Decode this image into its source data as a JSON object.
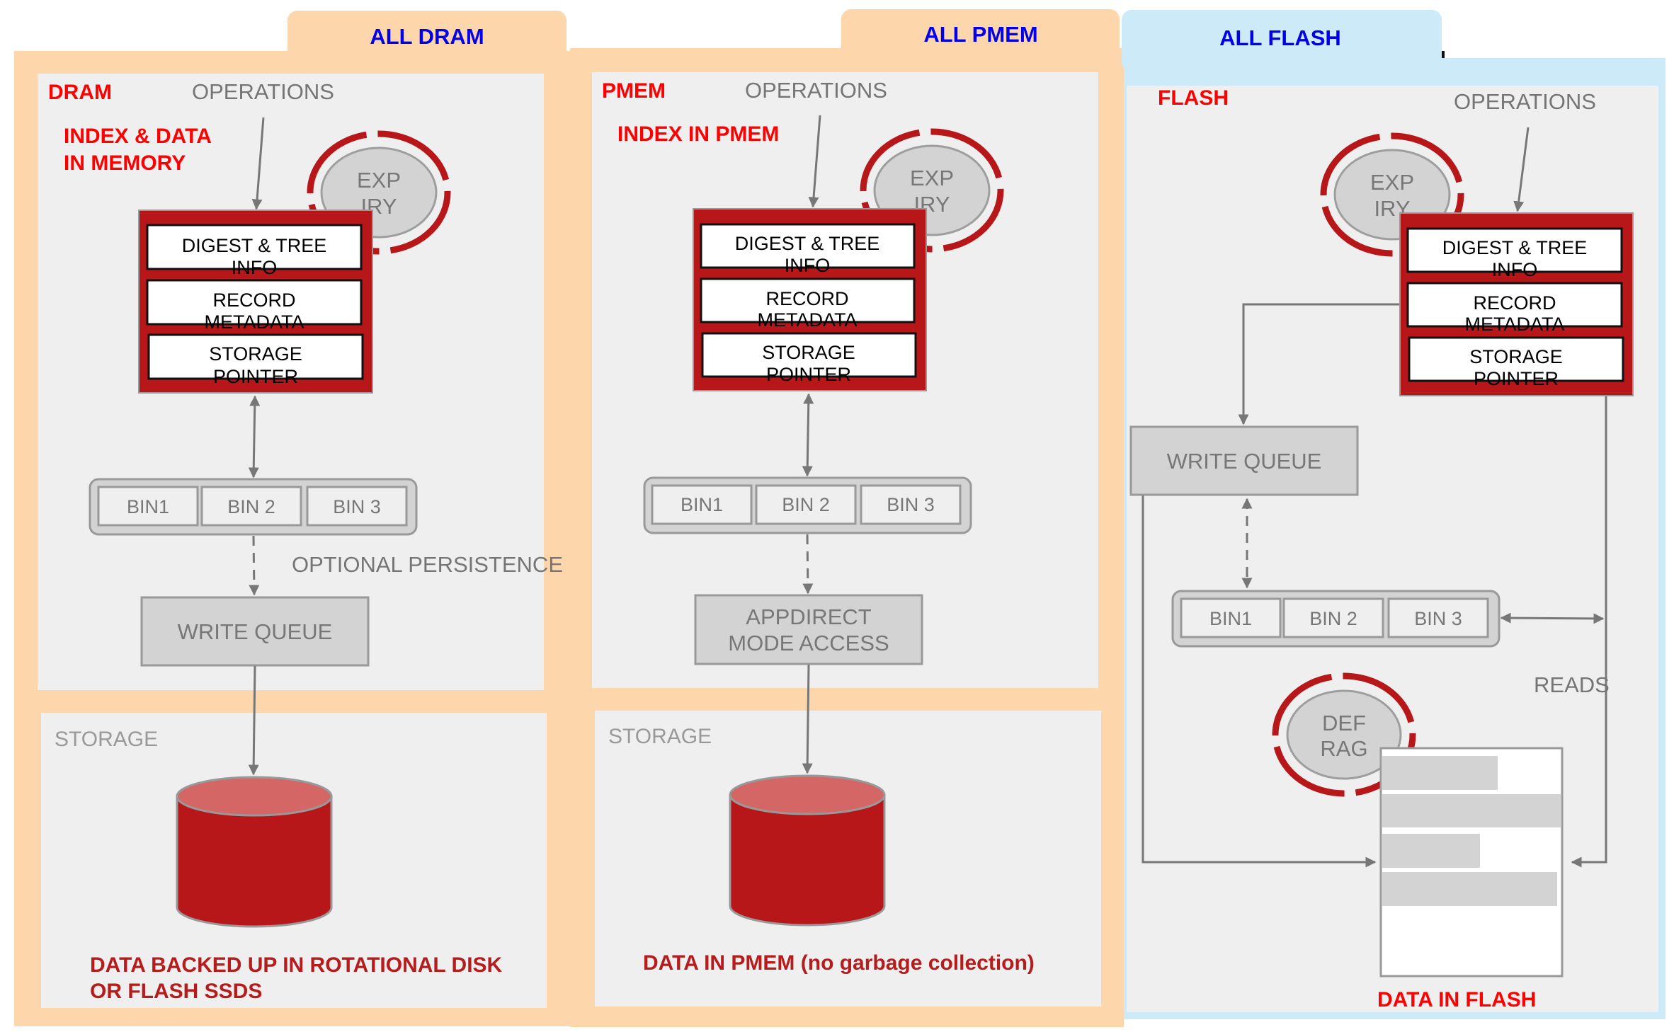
{
  "tabs": {
    "dram": "ALL DRAM",
    "pmem": "ALL PMEM",
    "flash": "ALL FLASH"
  },
  "colors": {
    "tab_title": "#0000ee",
    "zone_title": "#ff0000",
    "accent_red": "#b71719",
    "orange_frame": "#fed6ab",
    "blue_frame": "#cceaf7",
    "panel_gray": "#efefef"
  },
  "dram": {
    "zone_title": "DRAM",
    "operations": "OPERATIONS",
    "subtitle_line1": "INDEX & DATA",
    "subtitle_line2": "IN MEMORY",
    "expiry_line1": "EXP",
    "expiry_line2": "IRY",
    "index_boxes": [
      {
        "line1": "DIGEST & TREE",
        "line2": "INFO"
      },
      {
        "line1": "RECORD",
        "line2": "METADATA"
      },
      {
        "line1": "STORAGE",
        "line2": "POINTER"
      }
    ],
    "bins": [
      "BIN1",
      "BIN 2",
      "BIN 3"
    ],
    "persistence_label": "OPTIONAL PERSISTENCE",
    "queue_label": "WRITE QUEUE",
    "storage_label": "STORAGE",
    "caption_line1": "DATA BACKED UP IN ROTATIONAL DISK",
    "caption_line2": "OR FLASH SSDS"
  },
  "pmem": {
    "zone_title": "PMEM",
    "operations": "OPERATIONS",
    "subtitle": "INDEX IN PMEM",
    "expiry_line1": "EXP",
    "expiry_line2": "IRY",
    "index_boxes": [
      {
        "line1": "DIGEST & TREE",
        "line2": "INFO"
      },
      {
        "line1": "RECORD",
        "line2": "METADATA"
      },
      {
        "line1": "STORAGE",
        "line2": "POINTER"
      }
    ],
    "bins": [
      "BIN1",
      "BIN 2",
      "BIN 3"
    ],
    "access_line1": "APPDIRECT",
    "access_line2": "MODE ACCESS",
    "storage_label": "STORAGE",
    "caption": "DATA IN  PMEM (no garbage collection)"
  },
  "flash": {
    "zone_title": "FLASH",
    "operations": "OPERATIONS",
    "expiry_line1": "EXP",
    "expiry_line2": "IRY",
    "index_boxes": [
      {
        "line1": "DIGEST & TREE",
        "line2": "INFO"
      },
      {
        "line1": "RECORD",
        "line2": "METADATA"
      },
      {
        "line1": "STORAGE",
        "line2": "POINTER"
      }
    ],
    "queue_label": "WRITE QUEUE",
    "bins": [
      "BIN1",
      "BIN 2",
      "BIN 3"
    ],
    "reads_label": "READS",
    "defrag_line1": "DEF",
    "defrag_line2": "RAG",
    "caption": "DATA IN FLASH"
  }
}
